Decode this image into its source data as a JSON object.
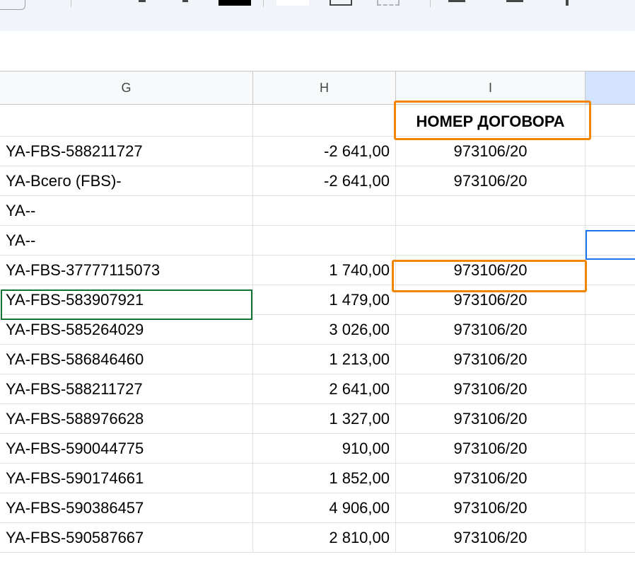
{
  "columns": {
    "g": "G",
    "h": "H",
    "i": "I"
  },
  "header_row": {
    "g": "",
    "h": "",
    "i": "НОМЕР ДОГОВОРА"
  },
  "rows": [
    {
      "g": "YA-FBS-588211727",
      "h": "-2 641,00",
      "i": "973106/20"
    },
    {
      "g": "YA-Всего (FBS)-",
      "h": "-2 641,00",
      "i": "973106/20"
    },
    {
      "g": "YA--",
      "h": "",
      "i": ""
    },
    {
      "g": "YA--",
      "h": "",
      "i": ""
    },
    {
      "g": "YA-FBS-37777115073",
      "h": "1 740,00",
      "i": "973106/20"
    },
    {
      "g": "YA-FBS-583907921",
      "h": "1 479,00",
      "i": "973106/20"
    },
    {
      "g": "YA-FBS-585264029",
      "h": "3 026,00",
      "i": "973106/20"
    },
    {
      "g": "YA-FBS-586846460",
      "h": "1 213,00",
      "i": "973106/20"
    },
    {
      "g": "YA-FBS-588211727",
      "h": "2 641,00",
      "i": "973106/20"
    },
    {
      "g": "YA-FBS-588976628",
      "h": "1 327,00",
      "i": "973106/20"
    },
    {
      "g": "YA-FBS-590044775",
      "h": "910,00",
      "i": "973106/20"
    },
    {
      "g": "YA-FBS-590174661",
      "h": "1 852,00",
      "i": "973106/20"
    },
    {
      "g": "YA-FBS-590386457",
      "h": "4 906,00",
      "i": "973106/20"
    },
    {
      "g": "YA-FBS-590587667",
      "h": "2 810,00",
      "i": "973106/20"
    }
  ],
  "colors": {
    "highlight_orange": "#f28500",
    "active_cell_green": "#137333",
    "selection_blue": "#1a73e8",
    "selected_header": "#d3e3fd"
  }
}
